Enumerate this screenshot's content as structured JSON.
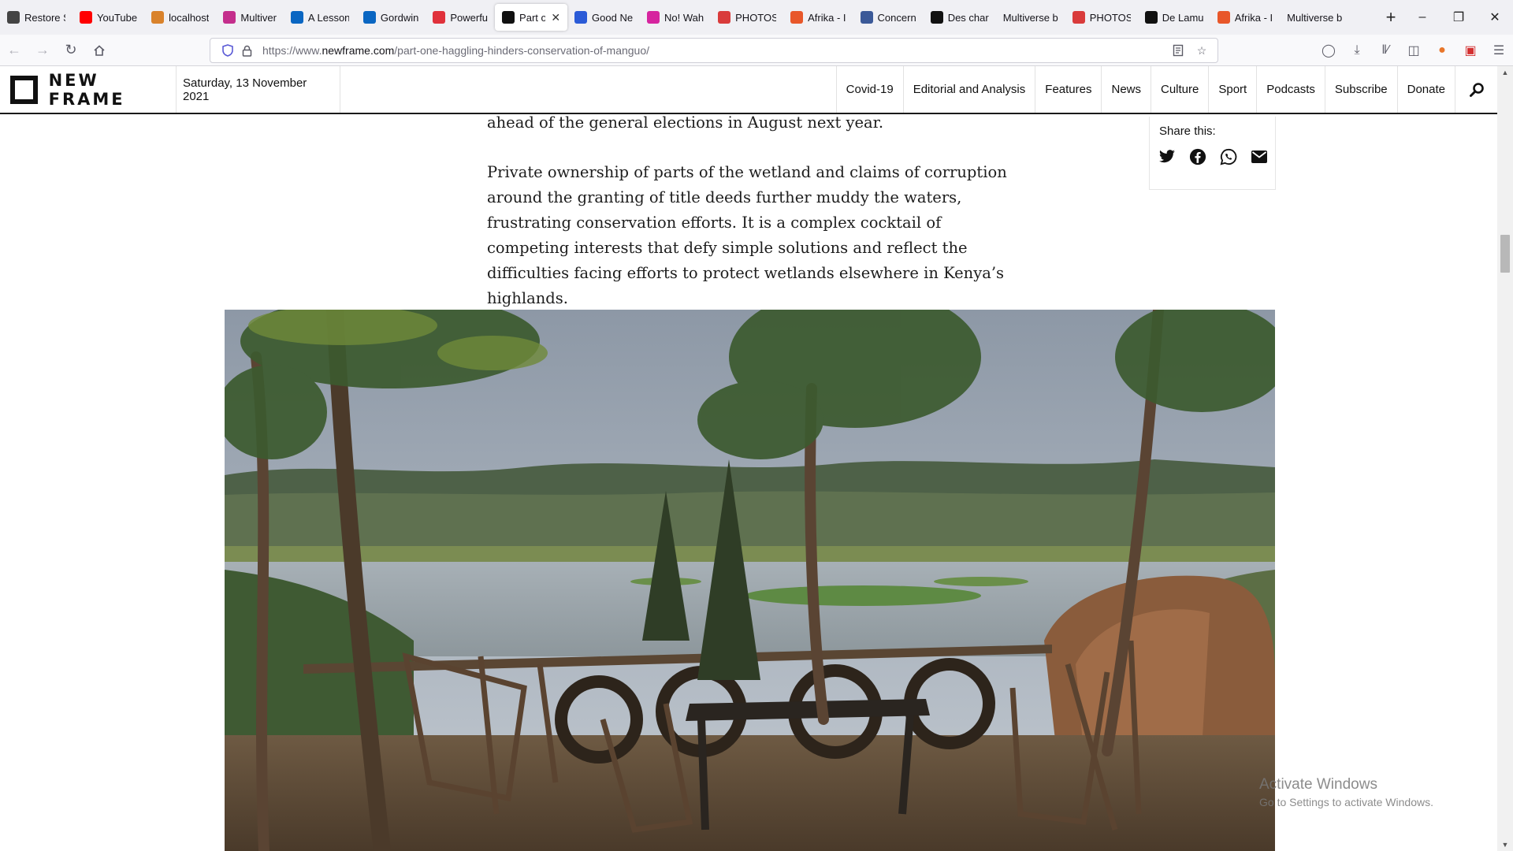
{
  "browser": {
    "tabs": [
      {
        "label": "Restore S",
        "icon": "info-icon",
        "color": "#444444"
      },
      {
        "label": "YouTube",
        "icon": "youtube-icon",
        "color": "#ff0000"
      },
      {
        "label": "localhost",
        "icon": "localhost-icon",
        "color": "#d9822b"
      },
      {
        "label": "Multiver",
        "icon": "multiverse-icon",
        "color": "#c42e8c"
      },
      {
        "label": "A Lesson",
        "icon": "linkedin-icon",
        "color": "#0a66c2"
      },
      {
        "label": "Gordwin",
        "icon": "linkedin-icon",
        "color": "#0a66c2"
      },
      {
        "label": "Powerfu",
        "icon": "rd-icon",
        "color": "#e0313b"
      },
      {
        "label": "Part o",
        "icon": "newframe-icon",
        "color": "#111111",
        "active": true
      },
      {
        "label": "Good Ne",
        "icon": "gn-icon",
        "color": "#2b5bd7"
      },
      {
        "label": "No! Wah",
        "icon": "instagram-icon",
        "color": "#d6249f"
      },
      {
        "label": "PHOTOS",
        "icon": "photos-icon",
        "color": "#d93b3b"
      },
      {
        "label": "Afrika - I",
        "icon": "s-icon",
        "color": "#e8572a"
      },
      {
        "label": "Concern",
        "icon": "g-icon",
        "color": "#3b5998"
      },
      {
        "label": "Des char",
        "icon": "f-icon",
        "color": "#111111"
      },
      {
        "label": "Multiverse b",
        "icon": "",
        "color": ""
      },
      {
        "label": "PHOTOS",
        "icon": "photos-icon",
        "color": "#d93b3b"
      },
      {
        "label": "De Lamu",
        "icon": "hii-icon",
        "color": "#111111"
      },
      {
        "label": "Afrika - I",
        "icon": "s-icon",
        "color": "#e8572a"
      },
      {
        "label": "Multiverse b",
        "icon": "",
        "color": ""
      }
    ],
    "url_prefix": "https://www.",
    "url_domain": "newframe.com",
    "url_path": "/part-one-haggling-hinders-conservation-of-manguo/"
  },
  "site": {
    "logo_text": "NEW FRAME",
    "date": "Saturday, 13 November 2021",
    "nav": [
      "Covid-19",
      "Editorial and Analysis",
      "Features",
      "News",
      "Culture",
      "Sport",
      "Podcasts",
      "Subscribe",
      "Donate"
    ]
  },
  "article": {
    "p1": "ahead of the general elections in August next year.",
    "p2": "Private ownership of parts of the wetland and claims of corruption around the granting of title deeds further muddy the waters, frustrating conservation efforts. It is a complex cocktail of competing interests that defy simple solutions and reflect the difficulties facing efforts to protect wetlands elsewhere in Kenya’s highlands."
  },
  "share": {
    "title": "Share this:"
  },
  "watermark": {
    "line1": "Activate Windows",
    "line2": "Go to Settings to activate Windows."
  }
}
